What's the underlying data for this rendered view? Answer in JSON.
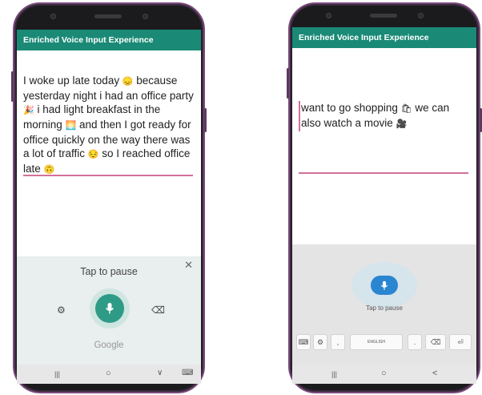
{
  "left_phone": {
    "app_title": "Enriched Voice Input Experience",
    "text_segments": [
      {
        "text": " I woke up late today "
      },
      {
        "emoji": "😞"
      },
      {
        "text": " because yesterday night i had an office party "
      },
      {
        "emoji": "🎉"
      },
      {
        "text": " i had light breakfast in the morning "
      },
      {
        "emoji": "🌅"
      },
      {
        "text": " and then I got ready for office quickly on the way there was a lot of traffic "
      },
      {
        "emoji": "😔"
      },
      {
        "text": " so I reached office late "
      },
      {
        "emoji": "🙃"
      }
    ],
    "voice": {
      "close_label": "✕",
      "tap_to_pause": "Tap to pause",
      "settings_icon": "⚙",
      "mic_icon": "mic-icon",
      "backspace_icon": "⌫",
      "google": "Google"
    },
    "nav": {
      "recents": "|||",
      "home": "○",
      "back": "∨",
      "keyboard": "⌨"
    }
  },
  "right_phone": {
    "app_title": "Enriched Voice Input Experience",
    "text_segments": [
      {
        "text": "want to go shopping "
      },
      {
        "emoji": "🛍"
      },
      {
        "text": " we can also watch a movie "
      },
      {
        "emoji": "🎥"
      }
    ],
    "voice": {
      "tap_to_pause": "Tap to pause",
      "mic_icon": "mic-icon"
    },
    "keys": {
      "keyboard_icon": "⌨",
      "settings_icon": "⚙",
      "comma": ",",
      "space": "ENGLISH",
      "period": ".",
      "backspace_icon": "⌫",
      "enter_icon": "⏎"
    },
    "nav": {
      "recents": "|||",
      "home": "○",
      "back": "<"
    }
  }
}
